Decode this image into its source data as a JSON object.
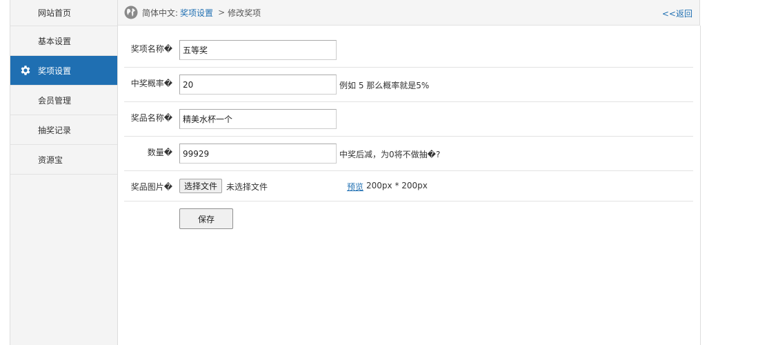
{
  "sidebar": {
    "items": [
      {
        "label": "网站首页"
      },
      {
        "label": "基本设置"
      },
      {
        "label": "奖项设置",
        "active": true,
        "icon": "gear-icon"
      },
      {
        "label": "会员管理"
      },
      {
        "label": "抽奖记录"
      },
      {
        "label": "资源宝"
      }
    ]
  },
  "header": {
    "language_label": "简体中文:",
    "breadcrumb_link": "奖项设置",
    "breadcrumb_separator": ">",
    "breadcrumb_current": "修改奖项",
    "back_label": "<<返回",
    "icon": "globe-icon"
  },
  "form": {
    "fields": [
      {
        "label": "奖项名称�",
        "value": "五等奖",
        "hint": ""
      },
      {
        "label": "中奖概率�",
        "value": "20",
        "hint": "例如 5 那么概率就是5%"
      },
      {
        "label": "奖品名称�",
        "value": "精美水杯一个",
        "hint": ""
      },
      {
        "label": "数量�",
        "value": "99929",
        "hint": "中奖后减，为0将不做抽�?"
      }
    ],
    "image": {
      "label": "奖品图片�",
      "file_button": "选择文件",
      "file_status": "未选择文件",
      "preview_link": "预览",
      "size_hint": "200px * 200px"
    },
    "save_label": "保存"
  },
  "colors": {
    "accent": "#1f6fb2",
    "sidebar_bg": "#f4f4f4",
    "topbar_bg": "#f5f5f5"
  }
}
